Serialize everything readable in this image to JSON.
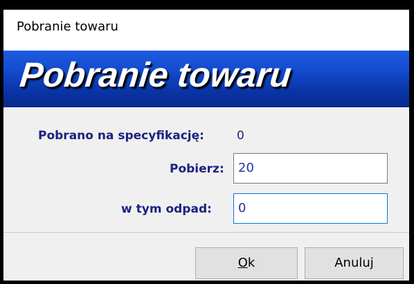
{
  "window": {
    "title": "Pobranie towaru"
  },
  "banner": {
    "text": "Pobranie towaru"
  },
  "form": {
    "collected_label": "Pobrano na specyfikację:",
    "collected_value": "0",
    "take_label": "Pobierz:",
    "take_value": "20",
    "waste_label": "w tym odpad:",
    "waste_value": "0"
  },
  "buttons": {
    "ok_accel": "O",
    "ok_rest": "k",
    "cancel": "Anuluj"
  }
}
